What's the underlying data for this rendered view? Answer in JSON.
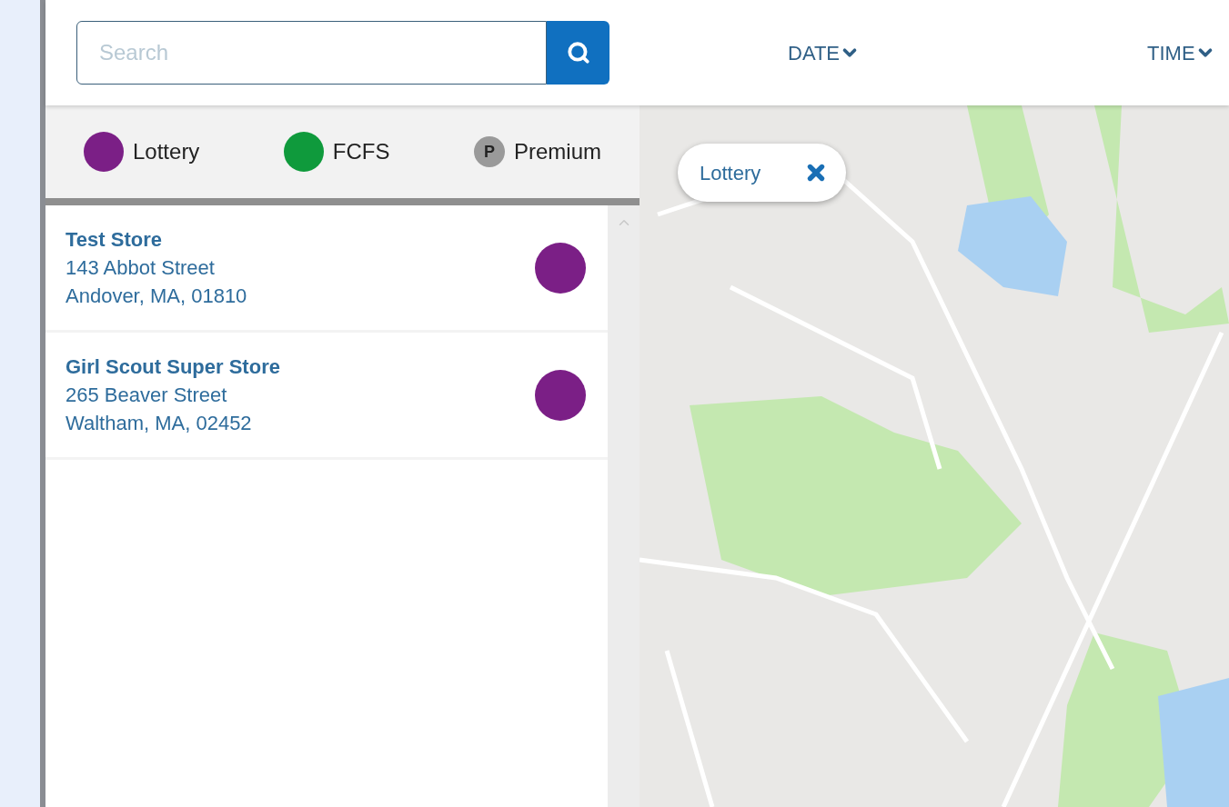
{
  "search": {
    "placeholder": "Search"
  },
  "filters": [
    {
      "label": "DATE"
    },
    {
      "label": "TIME"
    }
  ],
  "legend": [
    {
      "kind": "dot",
      "label": "Lottery",
      "color": "#7b1f86"
    },
    {
      "kind": "dot",
      "label": "FCFS",
      "color": "#0f9a3c"
    },
    {
      "kind": "letter",
      "letter": "P",
      "label": "Premium",
      "color": "#9a9a9a"
    }
  ],
  "stores": [
    {
      "name": "Test Store",
      "street": "143 Abbot Street",
      "city": "Andover, MA, 01810",
      "color": "#7b1f86"
    },
    {
      "name": "Girl Scout Super Store",
      "street": "265 Beaver Street",
      "city": "Waltham, MA, 02452",
      "color": "#7b1f86"
    }
  ],
  "map": {
    "chip": {
      "label": "Lottery"
    }
  }
}
